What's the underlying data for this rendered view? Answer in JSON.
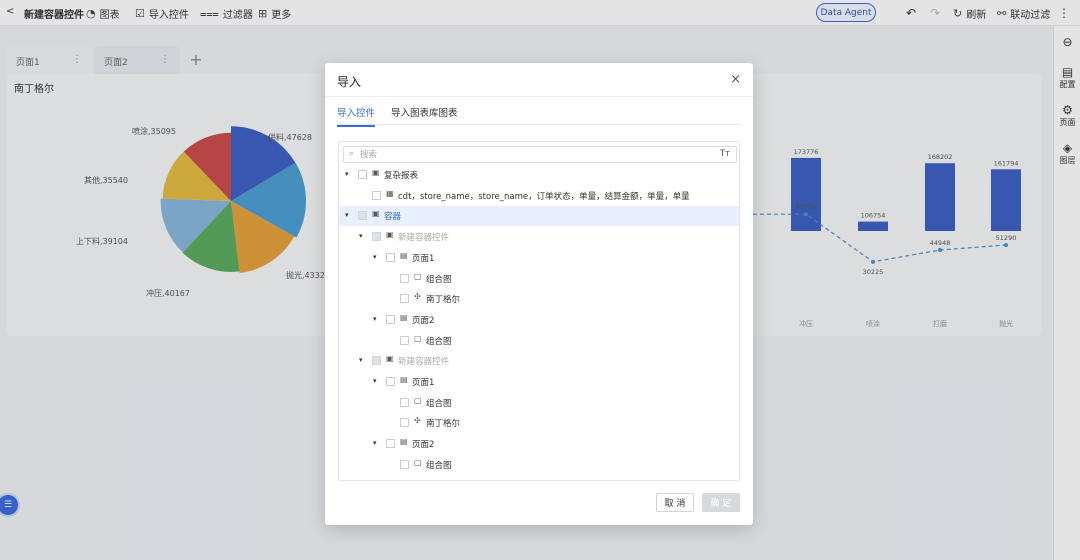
{
  "toolbar": {
    "back": "<",
    "title": "新建容器控件",
    "chart": "图表",
    "import": "导入控件",
    "filter": "过滤器",
    "more": "更多",
    "agent": "Data Agent",
    "refresh": "刷新",
    "linkage": "联动过滤"
  },
  "rail": {
    "config": "配置",
    "page": "页面",
    "layer": "图层"
  },
  "page_tabs": [
    {
      "label": "页面1"
    },
    {
      "label": "页面2"
    }
  ],
  "panel": {
    "title": "南丁格尔"
  },
  "chart_data": [
    {
      "type": "pie",
      "title": "",
      "labels": [
        "供料,47628",
        "抛光,4332",
        "冲压,40167",
        "上下料,39104",
        "其他,35540",
        "喷涂,35095"
      ],
      "slices": [
        {
          "name": "供料",
          "value": 47628,
          "color": "#3b5fc4"
        },
        {
          "name": "",
          "value": 48000,
          "color": "#4a9fd4"
        },
        {
          "name": "抛光",
          "value": 43320,
          "color": "#e8a13a"
        },
        {
          "name": "冲压",
          "value": 40167,
          "color": "#5aab5e"
        },
        {
          "name": "上下料",
          "value": 39104,
          "color": "#88b8dc"
        },
        {
          "name": "其他",
          "value": 35540,
          "color": "#e5bb3f"
        },
        {
          "name": "喷涂",
          "value": 35095,
          "color": "#cc4a4a"
        }
      ]
    },
    {
      "type": "bar",
      "categories": [
        "冲压",
        "喷涂",
        "打磨",
        "抛光"
      ],
      "bar_values": [
        173776,
        106754,
        168202,
        161794
      ],
      "line_values": [
        89754,
        30225,
        44948,
        51290
      ],
      "bar_color": "#3b5fc4"
    }
  ],
  "modal": {
    "title": "导入",
    "close": "×",
    "tabs": [
      "导入控件",
      "导入图表库图表"
    ],
    "search_placeholder": "搜索",
    "search_icon": "search-icon",
    "cancel": "取 消",
    "ok": "确 定",
    "tree": [
      {
        "level": 0,
        "label": "复杂报表",
        "icon": "report-icon",
        "arrow": "▾"
      },
      {
        "level": 1,
        "label": "cdt，store_name，store_name，订单状态，单量，结算金额，单量，单量",
        "icon": "table-icon"
      },
      {
        "level": 0,
        "label": "容器",
        "icon": "container-icon",
        "arrow": "▾",
        "selected": true
      },
      {
        "level": 1,
        "label": "新建容器控件",
        "icon": "container-icon",
        "arrow": "▾",
        "disabled": true
      },
      {
        "level": 2,
        "label": "页面1",
        "icon": "page-icon",
        "arrow": "▾"
      },
      {
        "level": 3,
        "label": "组合图",
        "icon": "combo-chart-icon"
      },
      {
        "level": 3,
        "label": "南丁格尔",
        "icon": "nightingale-icon"
      },
      {
        "level": 2,
        "label": "页面2",
        "icon": "page-icon",
        "arrow": "▾"
      },
      {
        "level": 3,
        "label": "组合图",
        "icon": "combo-chart-icon"
      },
      {
        "level": 1,
        "label": "新建容器控件",
        "icon": "container-icon",
        "arrow": "▾",
        "disabled": true
      },
      {
        "level": 2,
        "label": "页面1",
        "icon": "page-icon",
        "arrow": "▾"
      },
      {
        "level": 3,
        "label": "组合图",
        "icon": "combo-chart-icon"
      },
      {
        "level": 3,
        "label": "南丁格尔",
        "icon": "nightingale-icon"
      },
      {
        "level": 2,
        "label": "页面2",
        "icon": "page-icon",
        "arrow": "▾"
      },
      {
        "level": 3,
        "label": "组合图",
        "icon": "combo-chart-icon"
      }
    ]
  }
}
